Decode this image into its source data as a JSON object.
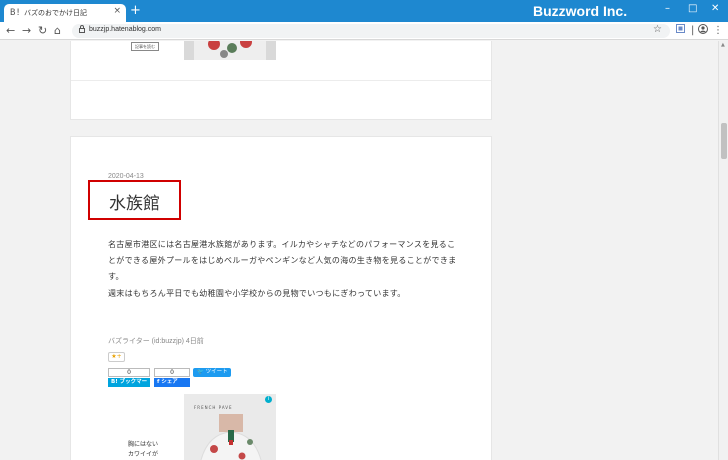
{
  "browser": {
    "tab_title": "バズのおでかけ日記",
    "tab_favicon": "hatena-blog-icon",
    "new_tab_glyph": "+",
    "tab_close_glyph": "×",
    "brand": "Buzzword Inc.",
    "url": "buzzjp.hatenablog.com"
  },
  "nav": {
    "back_glyph": "←",
    "forward_glyph": "→",
    "reload_glyph": "↻",
    "home_glyph": "⌂",
    "lock_glyph": "🔒",
    "star_glyph": "☆"
  },
  "window_controls": {
    "minimize": "–",
    "maximize": "□",
    "close": "✕"
  },
  "previous_post": {
    "mini_button_label": "記事を読む"
  },
  "post": {
    "date": "2020-04-13",
    "title": "水族館",
    "paragraph1": "名古屋市港区には名古屋港水族館があります。イルカやシャチなどのパフォーマンスを見ることができる屋外プールをはじめベルーガやペンギンなど人気の海の生き物を見ることができます。",
    "paragraph2": "週末はもちろん平日でも幼稚園や小学校からの見物でいつもにぎわっています。",
    "author": "バズライター (id:buzzjp) 4日前",
    "star_label": "★+",
    "bookmark_count": "0",
    "share_count": "0",
    "bookmark_label": "B! ブックマーク",
    "share_label": "f シェア",
    "tweet_label": "ツイート"
  },
  "ad": {
    "brand": "FRENCH PAVE",
    "text_line1": "胸にはない",
    "text_line2": "カワイイが",
    "info_glyph": "i"
  },
  "colors": {
    "titlebar": "#1e88d0",
    "highlight": "#d00000",
    "hatena_bookmark": "#00a4de",
    "facebook": "#1877f2",
    "twitter": "#1d9bf0"
  }
}
